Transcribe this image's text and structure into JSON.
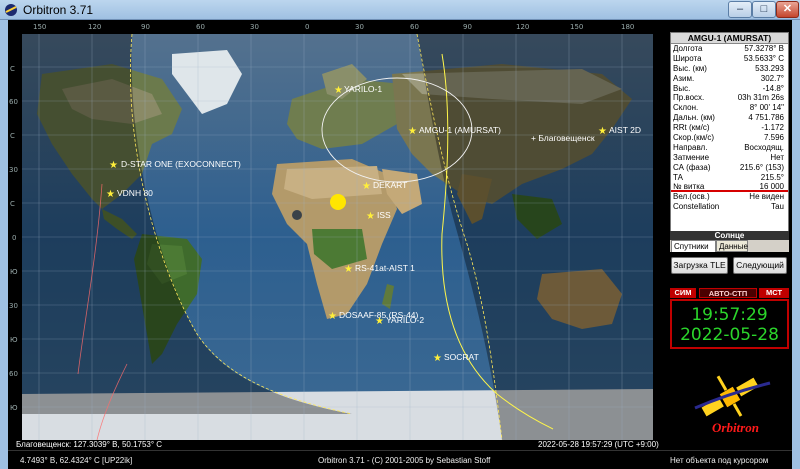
{
  "window": {
    "title": "Orbitron 3.71",
    "min_glyph": "–",
    "max_glyph": "□",
    "close_glyph": "✕"
  },
  "map": {
    "lon_ticks": [
      "150",
      "120",
      "90",
      "60",
      "30",
      "0",
      "30",
      "60",
      "90",
      "120",
      "150",
      "180"
    ],
    "lat_ticks": [
      "С",
      "60",
      "С",
      "30",
      "С",
      "0",
      "Ю",
      "30",
      "Ю",
      "60",
      "Ю"
    ],
    "satellites": [
      {
        "name": "YARILO-1"
      },
      {
        "name": "AMGU-1 (AMURSAT)"
      },
      {
        "name": "AIST 2D"
      },
      {
        "name": "D-STAR ONE (EXOCONNECT)"
      },
      {
        "name": "VDNH 80"
      },
      {
        "name": "DEKART"
      },
      {
        "name": "ISS"
      },
      {
        "name": "RS-41at-AIST 1"
      },
      {
        "name": "DOSAAF-85 (RS-44)"
      },
      {
        "name": "YARILO-2"
      },
      {
        "name": "SOCRAT"
      }
    ],
    "city_label": "+ Благовещенск",
    "colors": {
      "track": "#fff64a",
      "footprint": "#ffffff",
      "sun": "#ffe600",
      "ocean": "#3b6c99"
    }
  },
  "status": {
    "observer": "Благовещенск: 127.3039° В, 50.1753° С",
    "datetime": "2022-05-28 19:57:29 (UTC +9:00)",
    "coords": "4.7493° В, 62.4324° С [UP22ik]",
    "copyright": "Orbitron 3.71 - (C) 2001-2005 by Sebastian Stoff",
    "cursor": "Нет объекта под курсором"
  },
  "panel": {
    "sat_title": "AMGU-1 (AMURSAT)",
    "rows": [
      {
        "k": "Долгота",
        "v": "57.3278° В"
      },
      {
        "k": "Широта",
        "v": "53.5633° С"
      },
      {
        "k": "Выс. (км)",
        "v": "533.293"
      },
      {
        "k": "Азим.",
        "v": "302.7°"
      },
      {
        "k": "Выс.",
        "v": "-14.8°"
      },
      {
        "k": "Пр.восх.",
        "v": "03h 31m 26s"
      },
      {
        "k": "Склон.",
        "v": "8° 00' 14\""
      },
      {
        "k": "Дальн. (км)",
        "v": "4 751.786"
      },
      {
        "k": "RRt (км/с)",
        "v": "-1.172"
      },
      {
        "k": "Скор.(км/с)",
        "v": "7.596"
      },
      {
        "k": "Направл.",
        "v": "Восходящ."
      },
      {
        "k": "Затмение",
        "v": "Нет"
      },
      {
        "k": "СА (фаза)",
        "v": "215.6° (153)"
      },
      {
        "k": "ТА",
        "v": "215.5°"
      },
      {
        "k": "№ витка",
        "v": "16 000"
      },
      {
        "k": "Вел.(осв.)",
        "v": "Не виден"
      },
      {
        "k": "Constellation",
        "v": "Tau"
      }
    ],
    "sun_label": "Солнце",
    "tabs": [
      "Спутники",
      "Данные"
    ],
    "btn_tle": "Загрузка TLE",
    "btn_next": "Следующий",
    "mode_sim": "СИМ",
    "mode_auto": "АВТО-СТП",
    "mode_mst": "МСТ",
    "time": "19:57:29",
    "date": "2022-05-28",
    "logo_text": "Orbitron"
  }
}
